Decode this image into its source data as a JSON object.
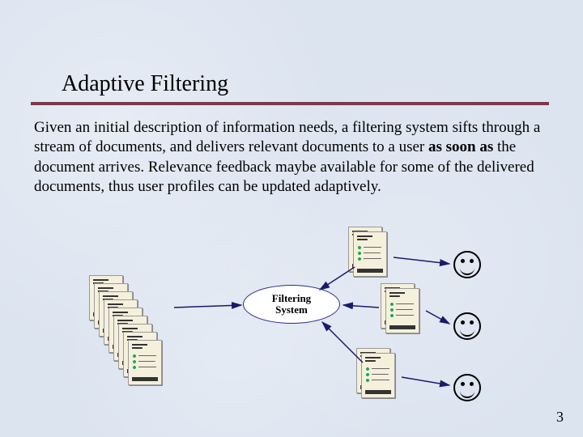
{
  "title": "Adaptive Filtering",
  "body": {
    "p1a": "Given an initial description of information needs, a filtering system sifts through a stream of documents, and delivers relevant documents to a user ",
    "p1b": "as soon as",
    "p1c": " the document arrives. Relevance feedback maybe available for some of the delivered documents, thus user profiles can be updated adaptively."
  },
  "filter_label_line1": "Filtering",
  "filter_label_line2": "System",
  "page_number": "3"
}
